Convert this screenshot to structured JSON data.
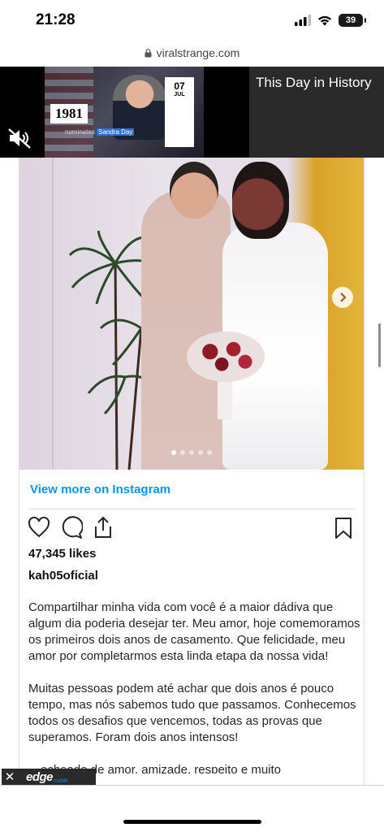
{
  "status_bar": {
    "time": "21:28",
    "battery": "39"
  },
  "url_bar": {
    "domain": "viralstrange.com"
  },
  "video": {
    "year": "1981",
    "caption_prefix": "nominates ",
    "caption_highlight": "Sandra Day",
    "day": "07",
    "month": "JUL",
    "title": "This Day in History"
  },
  "instagram": {
    "view_more": "View more on Instagram",
    "likes": "47,345 likes",
    "username": "kah05oficial",
    "carousel_dots": 5,
    "caption_paragraphs": [
      "Compartilhar minha vida com você é a maior dádiva que algum dia poderia desejar ter. Meu amor, hoje comemoramos os primeiros dois anos de casamento. Que felicidade, meu amor por completarmos esta linda etapa da nossa vida!",
      "Muitas pessoas podem até achar que dois anos é pouco tempo, mas nós sabemos tudo que passamos. Conhecemos todos os desafios que vencemos, todas as provas que superamos. Foram dois anos intensos!"
    ],
    "caption_clipped": "…echeado de amor, amizade, respeito e muito"
  },
  "ad": {
    "logo": "edge",
    "logo_sub": "mobile"
  }
}
